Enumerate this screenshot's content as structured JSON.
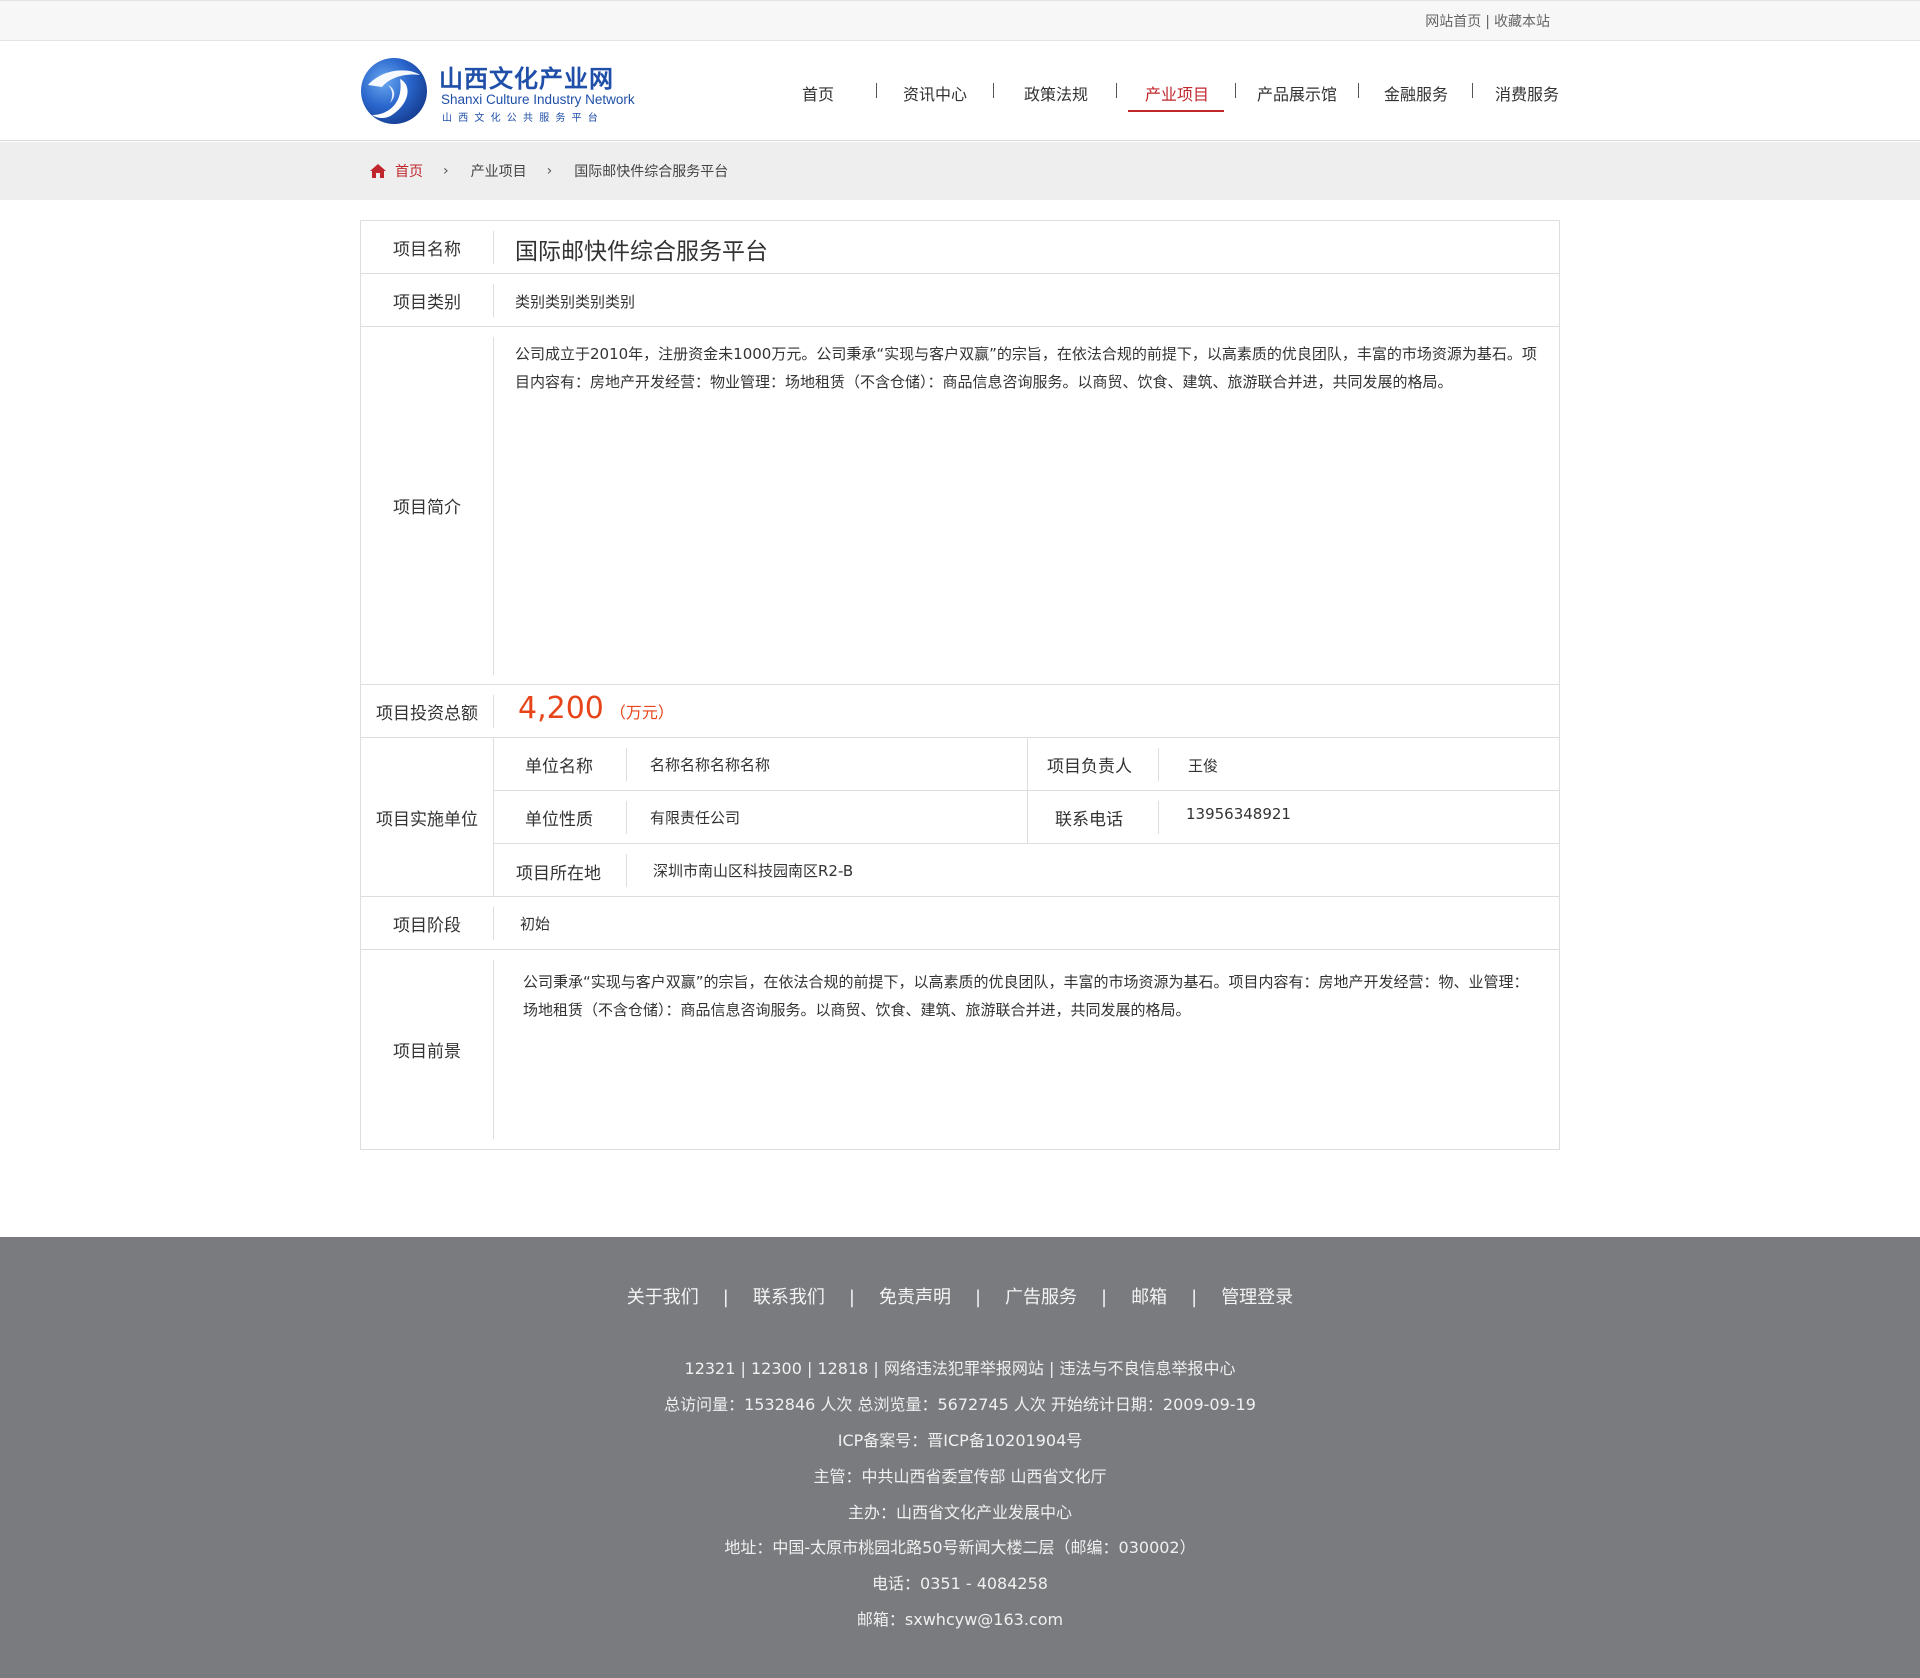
{
  "top_links": {
    "home": "网站首页",
    "separator": "|",
    "bookmark": "收藏本站"
  },
  "logo": {
    "cn": "山西文化产业网",
    "en": "Shanxi Culture Industry Network",
    "sub": "山西文化公共服务平台"
  },
  "nav": {
    "items": [
      {
        "label": "首页",
        "active": false
      },
      {
        "label": "资讯中心",
        "active": false
      },
      {
        "label": "政策法规",
        "active": false
      },
      {
        "label": "产业项目",
        "active": true
      },
      {
        "label": "产品展示馆",
        "active": false
      },
      {
        "label": "金融服务",
        "active": false
      },
      {
        "label": "消费服务",
        "active": false
      }
    ],
    "separator": "|",
    "active_color": "#c0272d"
  },
  "breadcrumb": {
    "home": "首页",
    "arrow": "›",
    "level1": "产业项目",
    "current": "国际邮快件综合服务平台"
  },
  "project": {
    "name_label": "项目名称",
    "name": "国际邮快件综合服务平台",
    "category_label": "项目类别",
    "category": "类别类别类别类别",
    "intro_label": "项目简介",
    "intro": "公司成立于2010年，注册资金未1000万元。公司秉承“实现与客户双赢”的宗旨，在依法合规的前提下，以高素质的优良团队，丰富的市场资源为基石。项目内容有：房地产开发经营：物业管理：场地租赁（不含仓储）：商品信息咨询服务。以商贸、饮食、建筑、旅游联合并进，共同发展的格局。",
    "investment_label": "项目投资总额",
    "investment_value": "4,200",
    "investment_unit": "（万元）",
    "investment_color": "#e8441a",
    "unit_label": "项目实施单位",
    "unit_name_label": "单位名称",
    "unit_name": "名称名称名称名称",
    "leader_label": "项目负责人",
    "leader": "王俊",
    "nature_label": "单位性质",
    "nature": "有限责任公司",
    "phone_label": "联系电话",
    "phone": "13956348921",
    "location_label": "项目所在地",
    "location": "深圳市南山区科技园南区R2-B",
    "stage_label": "项目阶段",
    "stage": "初始",
    "prospect_label": "项目前景",
    "prospect": "公司秉承“实现与客户双赢”的宗旨，在依法合规的前提下，以高素质的优良团队，丰富的市场资源为基石。项目内容有：房地产开发经营：物、业管理：场地租赁（不含仓储）：商品信息咨询服务。以商贸、饮食、建筑、旅游联合并进，共同发展的格局。"
  },
  "footer": {
    "links": [
      "关于我们",
      "联系我们",
      "免责声明",
      "广告服务",
      "邮箱",
      "管理登录"
    ],
    "separator": "|",
    "lines": [
      "12321 | 12300 | 12818 | 网络违法犯罪举报网站 | 违法与不良信息举报中心",
      "总访问量：1532846 人次  总浏览量：5672745 人次  开始统计日期：2009-09-19",
      "ICP备案号：晋ICP备10201904号",
      "主管：中共山西省委宣传部 山西省文化厅",
      "主办：山西省文化产业发展中心",
      "地址：中国-太原市桃园北路50号新闻大楼二层（邮编：030002）",
      "电话：0351 - 4084258",
      "邮箱：sxwhcyw@163.com"
    ],
    "background": "#797b7e"
  }
}
